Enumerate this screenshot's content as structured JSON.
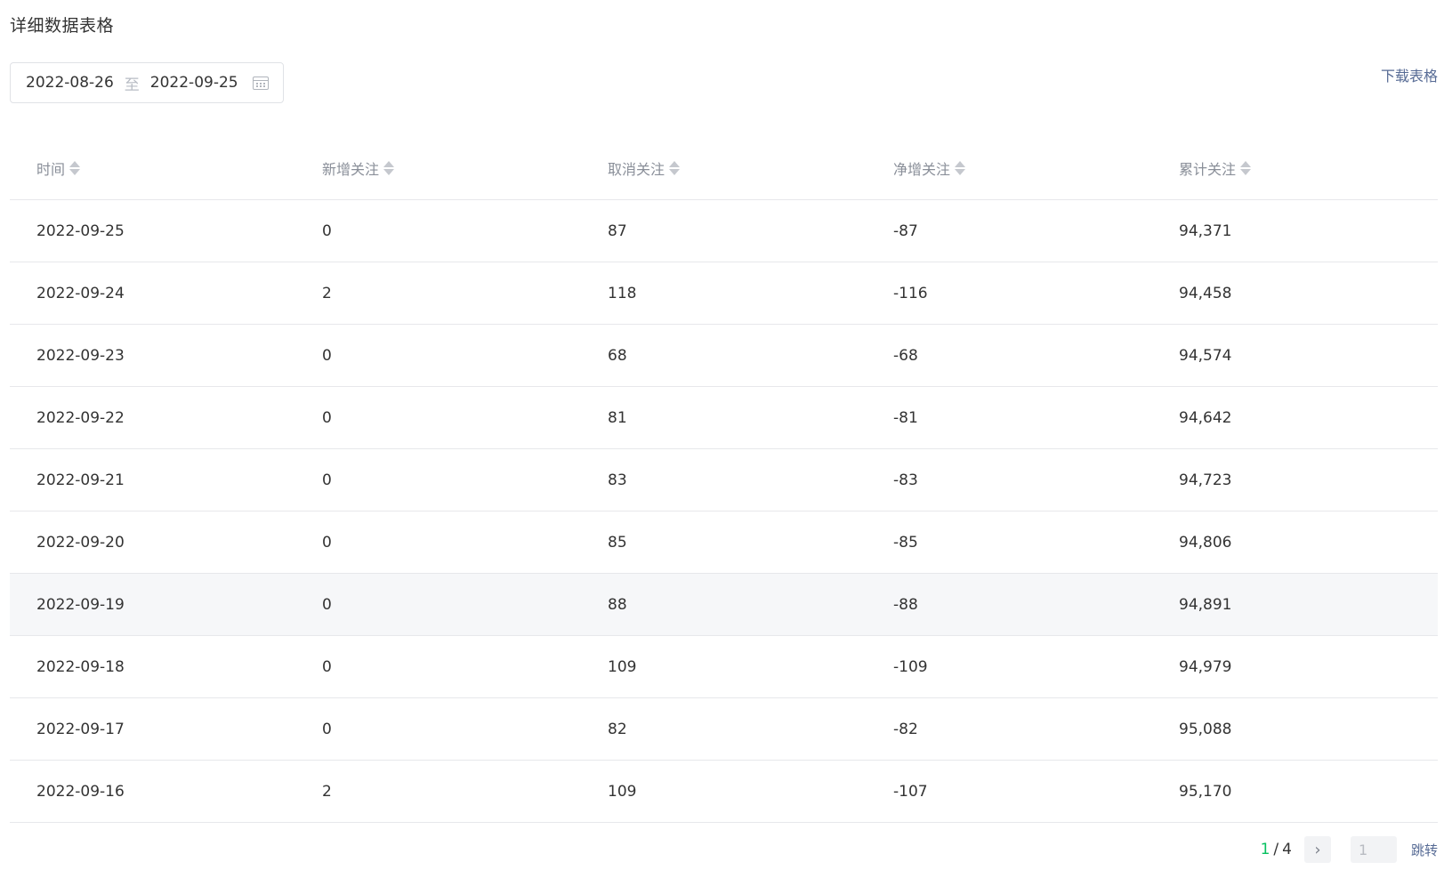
{
  "section": {
    "title": "详细数据表格"
  },
  "date_range": {
    "start": "2022-08-26",
    "separator": "至",
    "end": "2022-09-25"
  },
  "toolbar": {
    "download_label": "下载表格"
  },
  "table": {
    "columns": [
      "时间",
      "新增关注",
      "取消关注",
      "净增关注",
      "累计关注"
    ],
    "rows": [
      [
        "2022-09-25",
        "0",
        "87",
        "-87",
        "94,371"
      ],
      [
        "2022-09-24",
        "2",
        "118",
        "-116",
        "94,458"
      ],
      [
        "2022-09-23",
        "0",
        "68",
        "-68",
        "94,574"
      ],
      [
        "2022-09-22",
        "0",
        "81",
        "-81",
        "94,642"
      ],
      [
        "2022-09-21",
        "0",
        "83",
        "-83",
        "94,723"
      ],
      [
        "2022-09-20",
        "0",
        "85",
        "-85",
        "94,806"
      ],
      [
        "2022-09-19",
        "0",
        "88",
        "-88",
        "94,891"
      ],
      [
        "2022-09-18",
        "0",
        "109",
        "-109",
        "94,979"
      ],
      [
        "2022-09-17",
        "0",
        "82",
        "-82",
        "95,088"
      ],
      [
        "2022-09-16",
        "2",
        "109",
        "-107",
        "95,170"
      ]
    ]
  },
  "pagination": {
    "current": "1",
    "separator": "/",
    "total": "4",
    "next_icon": "chevron-right-icon",
    "input_placeholder": "1",
    "jump_label": "跳转"
  },
  "colors": {
    "accent": "#07c160",
    "link": "#576b95"
  }
}
